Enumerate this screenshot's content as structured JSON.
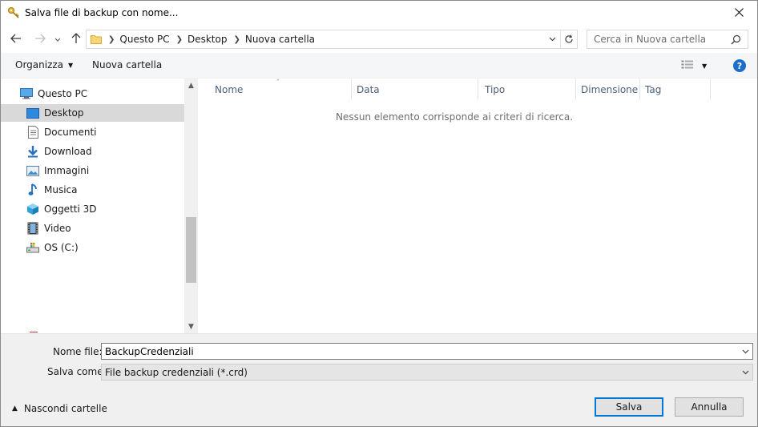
{
  "window": {
    "title": "Salva file di backup con nome..."
  },
  "address": {
    "crumbs": [
      "Questo PC",
      "Desktop",
      "Nuova cartella"
    ]
  },
  "search": {
    "placeholder": "Cerca in Nuova cartella"
  },
  "toolbar": {
    "organize_label": "Organizza",
    "new_folder_label": "Nuova cartella",
    "help_glyph": "?"
  },
  "navpane": {
    "root": "Questo PC",
    "items": [
      {
        "label": "Desktop",
        "icon": "desktop-icon",
        "selected": true
      },
      {
        "label": "Documenti",
        "icon": "documents-icon"
      },
      {
        "label": "Download",
        "icon": "download-icon"
      },
      {
        "label": "Immagini",
        "icon": "pictures-icon"
      },
      {
        "label": "Musica",
        "icon": "music-icon"
      },
      {
        "label": "Oggetti 3D",
        "icon": "3d-objects-icon"
      },
      {
        "label": "Video",
        "icon": "video-icon"
      },
      {
        "label": "OS (C:)",
        "icon": "drive-icon"
      }
    ]
  },
  "filepane": {
    "columns": [
      "Nome",
      "Data",
      "Tipo",
      "Dimensione",
      "Tag"
    ],
    "empty_message": "Nessun elemento corrisponde ai criteri di ricerca."
  },
  "form": {
    "filename_label": "Nome file:",
    "filename_value": "BackupCredenziali",
    "savetype_label": "Salva come:",
    "savetype_value": "File backup credenziali (*.crd)"
  },
  "footer": {
    "hide_folders_label": "Nascondi cartelle",
    "save_label": "Salva",
    "cancel_label": "Annulla"
  },
  "colors": {
    "accent": "#0078d7",
    "selected_bg": "#d9d9d9",
    "column_header_text": "#4c607a"
  }
}
